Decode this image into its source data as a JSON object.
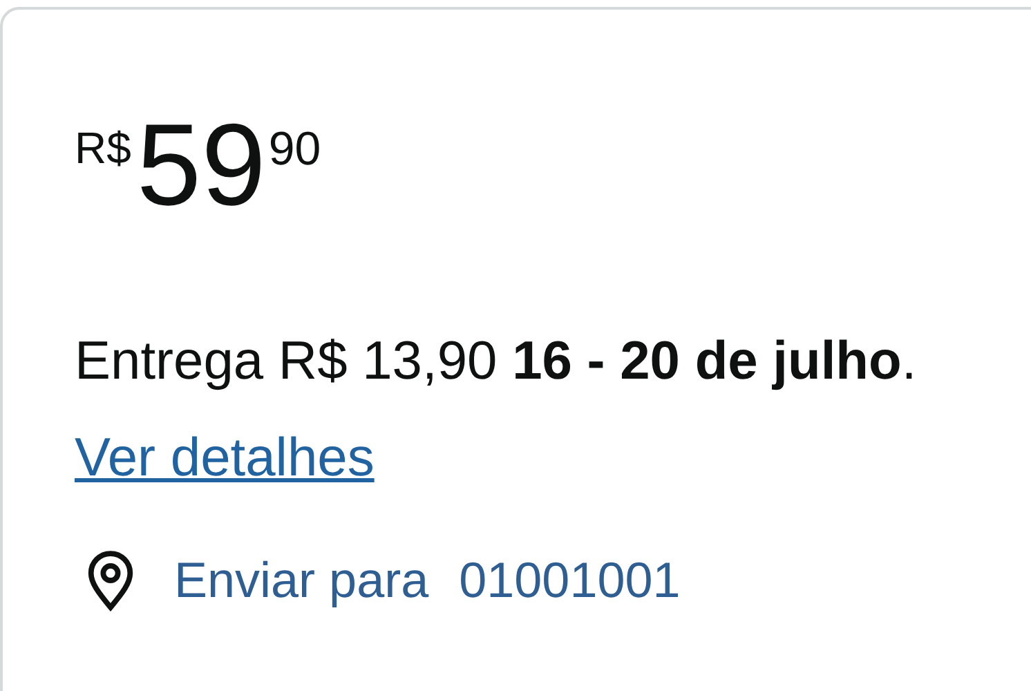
{
  "price": {
    "currency": "R$",
    "whole": "59",
    "cents": "90"
  },
  "delivery": {
    "text": "Entrega R$ 13,90 **16 - 20 de julho**.",
    "link": "Ver detalhes"
  },
  "ship_to": {
    "label": "Enviar para",
    "zip": "01001001"
  }
}
